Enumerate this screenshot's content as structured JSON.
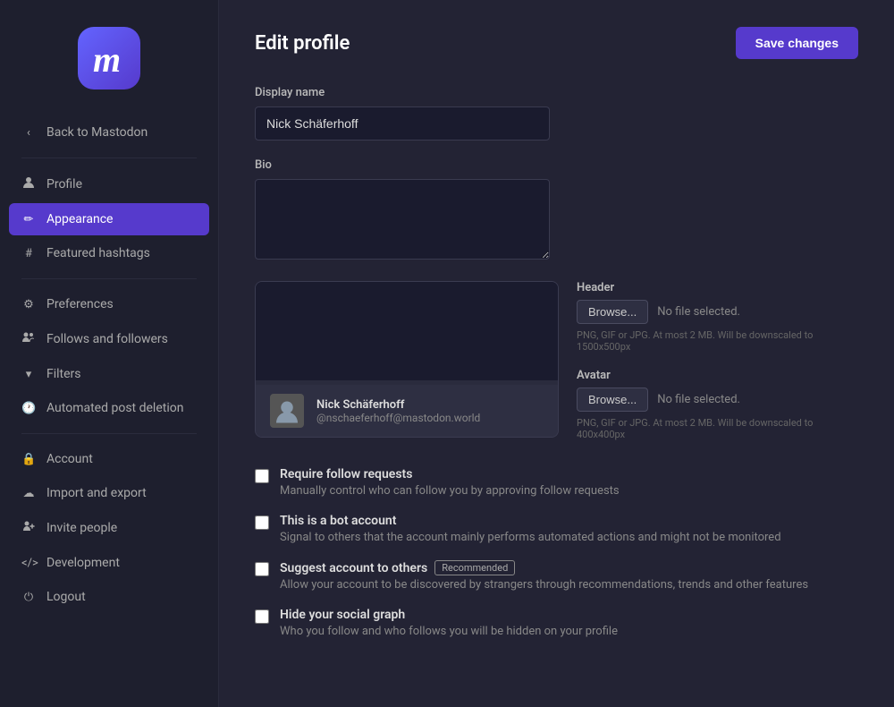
{
  "sidebar": {
    "logo_letter": "m",
    "back_label": "Back to Mastodon",
    "items": [
      {
        "id": "profile",
        "label": "Profile",
        "icon": "👤"
      },
      {
        "id": "appearance",
        "label": "Appearance",
        "icon": "✏️",
        "active": true
      },
      {
        "id": "featured-hashtags",
        "label": "Featured hashtags",
        "icon": "#"
      },
      {
        "id": "preferences",
        "label": "Preferences",
        "icon": "⚙️"
      },
      {
        "id": "follows-followers",
        "label": "Follows and followers",
        "icon": "👥"
      },
      {
        "id": "filters",
        "label": "Filters",
        "icon": "▾"
      },
      {
        "id": "automated-post-deletion",
        "label": "Automated post deletion",
        "icon": "🕐"
      },
      {
        "id": "account",
        "label": "Account",
        "icon": "🔒"
      },
      {
        "id": "import-export",
        "label": "Import and export",
        "icon": "☁️"
      },
      {
        "id": "invite-people",
        "label": "Invite people",
        "icon": "👤+"
      },
      {
        "id": "development",
        "label": "Development",
        "icon": "<>"
      },
      {
        "id": "logout",
        "label": "Logout",
        "icon": "⏻"
      }
    ]
  },
  "page": {
    "title": "Edit profile",
    "save_label": "Save changes"
  },
  "form": {
    "display_name_label": "Display name",
    "display_name_value": "Nick Schäferhoff",
    "bio_label": "Bio",
    "bio_value": "",
    "bio_placeholder": "",
    "header_label": "Header",
    "header_browse": "Browse...",
    "header_no_file": "No file selected.",
    "header_hint": "PNG, GIF or JPG. At most 2 MB. Will be downscaled to 1500x500px",
    "avatar_label": "Avatar",
    "avatar_browse": "Browse...",
    "avatar_no_file": "No file selected.",
    "avatar_hint": "PNG, GIF or JPG. At most 2 MB. Will be downscaled to 400x400px"
  },
  "profile_preview": {
    "name": "Nick Schäferhoff",
    "handle": "@nschaeferhoff@mastodon.world"
  },
  "checkboxes": [
    {
      "id": "require-follow-requests",
      "label": "Require follow requests",
      "description": "Manually control who can follow you by approving follow requests",
      "checked": false,
      "badge": null
    },
    {
      "id": "bot-account",
      "label": "This is a bot account",
      "description": "Signal to others that the account mainly performs automated actions and might not be monitored",
      "checked": false,
      "badge": null
    },
    {
      "id": "suggest-account",
      "label": "Suggest account to others",
      "description": "Allow your account to be discovered by strangers through recommendations, trends and other features",
      "checked": false,
      "badge": "Recommended"
    },
    {
      "id": "hide-social-graph",
      "label": "Hide your social graph",
      "description": "Who you follow and who follows you will be hidden on your profile",
      "checked": false,
      "badge": null
    }
  ]
}
